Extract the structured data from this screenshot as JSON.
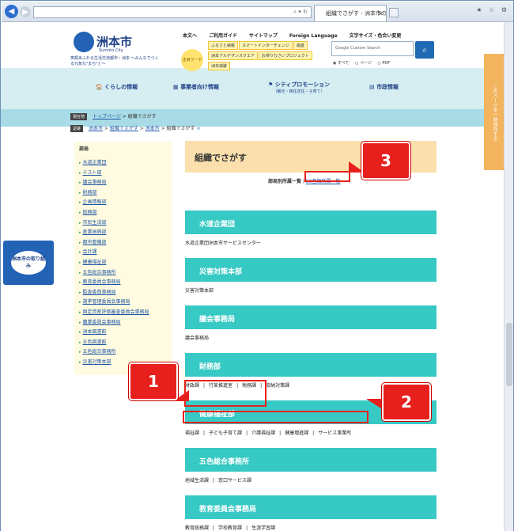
{
  "browser": {
    "address": "",
    "tab_title": "組織でさがす - 洲本市の...",
    "tab_close": "×",
    "window_icons": "★ ☆ ⚙"
  },
  "header": {
    "logo_name": "洲本市",
    "logo_en": "Sumoto City",
    "logo_tagline": "笑顔あふれる生活交流都市・洲本 〜みんなでつくる元気な\"まち\"と〜",
    "toplinks": [
      "本文へ",
      "ご利用ガイド",
      "サイトマップ",
      "Foreign Language",
      "文字サイズ・色合い変更"
    ],
    "chumoku": "注目ワード",
    "tags": [
      "ふるさと納税",
      "スマートインターチェンジ",
      "最盛",
      "洲本アルチザンスクエア",
      "お帰りなさいプロジェクト",
      "洲本城跡"
    ],
    "search_placeholder": "Google Custom Search",
    "radio_options": [
      "◉ すべて",
      "○ ページ",
      "○ PDF"
    ]
  },
  "mainnav": [
    {
      "label": "くらしの情報",
      "sub": ""
    },
    {
      "label": "事業者向け情報",
      "sub": ""
    },
    {
      "label": "シティプロモーション",
      "sub": "（観光・移住定住・子育て）"
    },
    {
      "label": "市政情報",
      "sub": ""
    }
  ],
  "side_banner": "このページを一時保存する",
  "torikumi": "洲本市の取り組み",
  "breadcrumb": {
    "current_label": "現在地",
    "current_links": [
      "トップページ",
      "組織でさがす"
    ],
    "footprint_label": "足跡",
    "footprint_links": [
      "洲本市",
      "組織でさがす",
      "洲本市",
      "組織でさがす"
    ]
  },
  "sidebar": {
    "heading": "部局",
    "items": [
      "水道企業団",
      "テスト部",
      "議会事務局",
      "財務部",
      "企画情報部",
      "総務部",
      "市民生活部",
      "産業振興部",
      "都市整備部",
      "会計課",
      "健康福祉部",
      "五色総合事務所",
      "教育委員会事務局",
      "監査委員事務局",
      "選挙管理委員会事務局",
      "固定資産評価審査委員会事務局",
      "農業委員会事務局",
      "洲本図書館",
      "五色図書館",
      "五色総合事務所",
      "災害対策本部"
    ]
  },
  "content": {
    "title": "組織でさがす",
    "link_label": "部局別所属一覧",
    "link_sep": "|",
    "link_50": "50音順所属一覧",
    "sections": [
      {
        "name": "水道企業団",
        "desc": [
          "水道企業団洲本市サービスセンター"
        ]
      },
      {
        "name": "災害対策本部",
        "desc": [
          "災害対策本部"
        ]
      },
      {
        "name": "議会事務局",
        "desc": [
          "議会事務局"
        ]
      },
      {
        "name": "財務部",
        "desc": [
          "財政課",
          "行革推進室",
          "税務課",
          "収納対策課"
        ]
      },
      {
        "name": "健康福祉部",
        "desc": [
          "福祉課",
          "子ども子育て課",
          "介護福祉課",
          "健康増進課",
          "サービス事業所"
        ]
      },
      {
        "name": "五色総合事務所",
        "desc": [
          "地域生活課",
          "窓口サービス課"
        ]
      },
      {
        "name": "教育委員会事務局",
        "desc": [
          "教育総務課",
          "学校教育課",
          "生涯学習課"
        ]
      }
    ]
  },
  "callouts": [
    "1",
    "2",
    "3"
  ],
  "colors": {
    "teal": "#37c9c4",
    "red": "#e8201d",
    "navy": "#1d3f86",
    "title_bg": "#fbe0ad"
  }
}
